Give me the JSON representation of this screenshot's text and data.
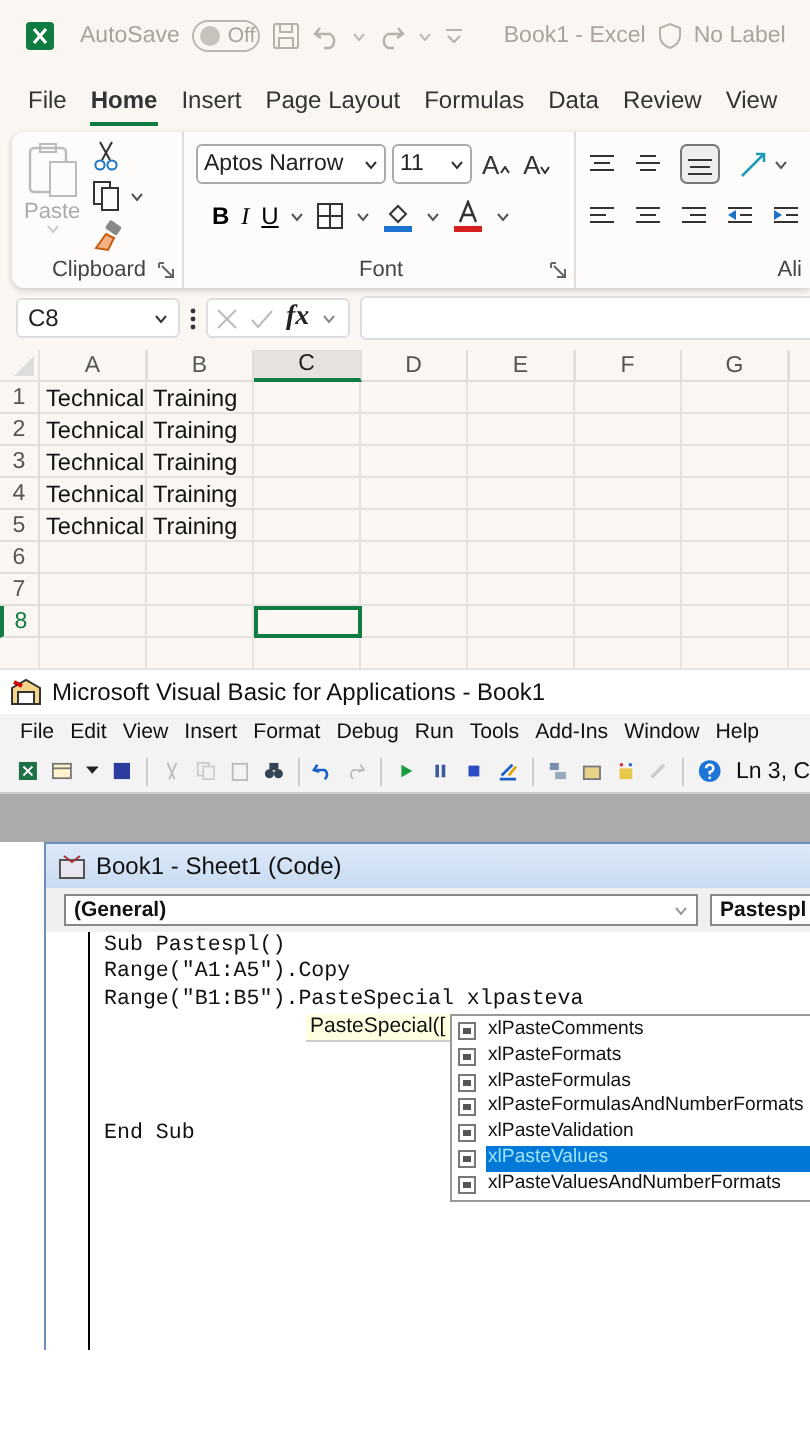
{
  "excel": {
    "title_bar": {
      "autosave_label": "AutoSave",
      "autosave_on": false,
      "autosave_state": "Off",
      "document_title": "Book1  -  Excel",
      "sensitivity": "No Label"
    },
    "ribbon_tabs": [
      {
        "label": "File",
        "selected": false
      },
      {
        "label": "Home",
        "selected": true
      },
      {
        "label": "Insert",
        "selected": false
      },
      {
        "label": "Page Layout",
        "selected": false
      },
      {
        "label": "Formulas",
        "selected": false
      },
      {
        "label": "Data",
        "selected": false
      },
      {
        "label": "Review",
        "selected": false
      },
      {
        "label": "View",
        "selected": false
      }
    ],
    "ribbon": {
      "paste_label": "Paste",
      "clipboard_label": "Clipboard",
      "font_name": "Aptos Narrow",
      "font_size": "11",
      "grow_font": "A",
      "shrink_font": "A",
      "bold": "B",
      "italic": "I",
      "underline": "U",
      "font_label": "Font",
      "alignment_label": "Ali"
    },
    "formula_bar": {
      "name_box": "C8",
      "function_label": "fx"
    },
    "sheet": {
      "columns": [
        {
          "label": "A",
          "selected": false
        },
        {
          "label": "B",
          "selected": false
        },
        {
          "label": "C",
          "selected": true
        },
        {
          "label": "D",
          "selected": false
        },
        {
          "label": "E",
          "selected": false
        },
        {
          "label": "F",
          "selected": false
        },
        {
          "label": "G",
          "selected": false
        }
      ],
      "rows": [
        {
          "header": "1",
          "selected": false,
          "cells": [
            "Technical",
            "Training"
          ]
        },
        {
          "header": "2",
          "selected": false,
          "cells": [
            "Technical",
            "Training"
          ]
        },
        {
          "header": "3",
          "selected": false,
          "cells": [
            "Technical",
            "Training"
          ]
        },
        {
          "header": "4",
          "selected": false,
          "cells": [
            "Technical",
            "Training"
          ]
        },
        {
          "header": "5",
          "selected": false,
          "cells": [
            "Technical",
            "Training"
          ]
        },
        {
          "header": "6",
          "selected": false
        },
        {
          "header": "7",
          "selected": false
        },
        {
          "header": "8",
          "selected": true
        }
      ]
    }
  },
  "vba": {
    "title": "Microsoft Visual Basic for Applications - Book1",
    "menu": [
      "File",
      "Edit",
      "View",
      "Insert",
      "Format",
      "Debug",
      "Run",
      "Tools",
      "Add-Ins",
      "Window",
      "Help"
    ],
    "status": "Ln 3, C",
    "code_window": {
      "title": "Book1 - Sheet1 (Code)",
      "object_combo": "(General)",
      "procedure_combo": "Pastespl",
      "code_lines": [
        "Sub Pastespl()",
        "Range(\"A1:A5\").Copy",
        "Range(\"B1:B5\").PasteSpecial xlpasteva"
      ],
      "end_line": "End Sub",
      "tooltip": "PasteSpecial([",
      "completions": [
        {
          "label": "xlPasteComments",
          "selected": false
        },
        {
          "label": "xlPasteFormats",
          "selected": false
        },
        {
          "label": "xlPasteFormulas",
          "selected": false
        },
        {
          "label": "xlPasteFormulasAndNumberFormats",
          "selected": false
        },
        {
          "label": "xlPasteValidation",
          "selected": false
        },
        {
          "label": "xlPasteValues",
          "selected": true
        },
        {
          "label": "xlPasteValuesAndNumberFormats",
          "selected": false
        }
      ]
    }
  }
}
